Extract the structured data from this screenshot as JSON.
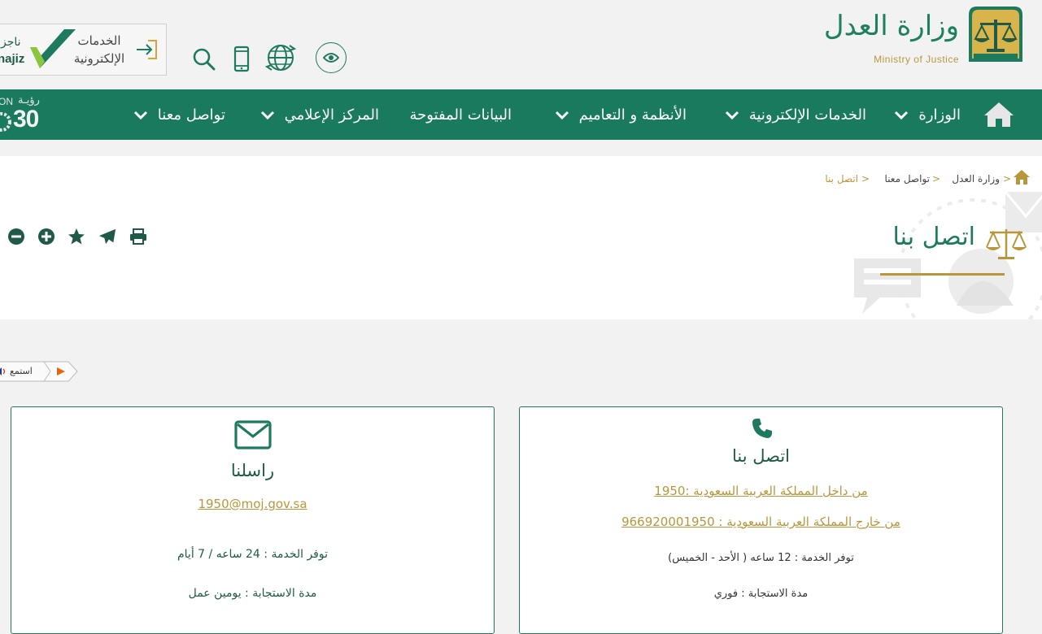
{
  "header": {
    "logo_ar": "وزارة العدل",
    "logo_en": "Ministry of Justice",
    "eservices_label_line1": "الخدمات",
    "eservices_label_line2": "الإلكترونية",
    "najiz_ar": "ناجز",
    "najiz_en": "najiz"
  },
  "nav": {
    "items": [
      {
        "label": "الوزارة",
        "has_dropdown": true
      },
      {
        "label": "الخدمات الإلكترونية",
        "has_dropdown": true
      },
      {
        "label": "الأنظمة و التعاميم",
        "has_dropdown": true
      },
      {
        "label": "البيانات المفتوحة",
        "has_dropdown": false
      },
      {
        "label": "المركز الإعلامي",
        "has_dropdown": true
      },
      {
        "label": "تواصل معنا",
        "has_dropdown": true
      }
    ],
    "vision_ar": "رؤيـة",
    "vision_num": "30",
    "vision_en": "ON"
  },
  "breadcrumb": {
    "items": [
      "وزارة العدل",
      "تواصل معنا",
      "اتصل بنا"
    ],
    "separator": ">"
  },
  "page": {
    "title": "اتصل بنا"
  },
  "listen": {
    "label": "استمع"
  },
  "cards": {
    "contact": {
      "title": "اتصل بنا",
      "inside_link": "من داخل المملكة العربية السعودية :1950",
      "outside_link": "من خارج المملكة العربية السعودية : 966920001950",
      "availability": "توفر الخدمة : 12 ساعه ( الأحد - الخميس)",
      "response": "مدة الاستجابة : فوري"
    },
    "email": {
      "title": "راسلنا",
      "email_link": "1950@moj.gov.sa",
      "availability": "توفر الخدمة : 24 ساعه / 7 أيام",
      "response": "مدة الاستجابة : يومين عمل"
    }
  },
  "colors": {
    "primary_green": "#197a5e",
    "gold": "#b8973c",
    "background": "#f2f2f2"
  }
}
